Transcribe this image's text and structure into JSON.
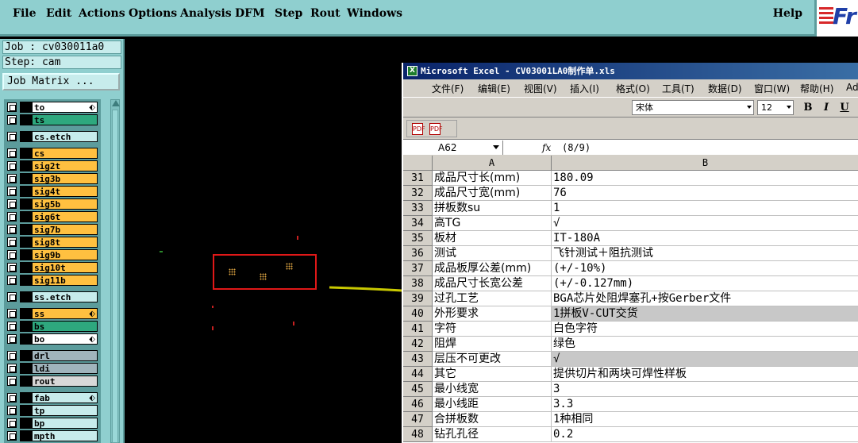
{
  "menu": {
    "items": [
      "File",
      "Edit",
      "Actions",
      "Options",
      "Analysis",
      "DFM",
      "Step",
      "Rout",
      "Windows"
    ],
    "help": "Help",
    "logo": "Fr"
  },
  "job": {
    "job_line": "Job : cv030011a0",
    "step_line": "Step: cam",
    "matrix_button": "Job Matrix ..."
  },
  "layers": [
    {
      "name": "to",
      "color": "#ffffff",
      "mark": "⬖"
    },
    {
      "name": "ts",
      "color": "#2ea87e",
      "mark": ""
    },
    {
      "name": "cs.etch",
      "color": "#c7ecec",
      "mark": ""
    },
    {
      "name": "cs",
      "color": "#ffc040",
      "mark": ""
    },
    {
      "name": "sig2t",
      "color": "#ffc040",
      "mark": ""
    },
    {
      "name": "sig3b",
      "color": "#ffc040",
      "mark": ""
    },
    {
      "name": "sig4t",
      "color": "#ffc040",
      "mark": ""
    },
    {
      "name": "sig5b",
      "color": "#ffc040",
      "mark": ""
    },
    {
      "name": "sig6t",
      "color": "#ffc040",
      "mark": ""
    },
    {
      "name": "sig7b",
      "color": "#ffc040",
      "mark": ""
    },
    {
      "name": "sig8t",
      "color": "#ffc040",
      "mark": ""
    },
    {
      "name": "sig9b",
      "color": "#ffc040",
      "mark": ""
    },
    {
      "name": "sig10t",
      "color": "#ffc040",
      "mark": ""
    },
    {
      "name": "sig11b",
      "color": "#ffc040",
      "mark": ""
    },
    {
      "name": "ss.etch",
      "color": "#c7ecec",
      "mark": ""
    },
    {
      "name": "ss",
      "color": "#ffc040",
      "mark": "⬖"
    },
    {
      "name": "bs",
      "color": "#2ea87e",
      "mark": ""
    },
    {
      "name": "bo",
      "color": "#ffffff",
      "mark": "⬖"
    },
    {
      "name": "drl",
      "color": "#a0b4bc",
      "mark": ""
    },
    {
      "name": "ldi",
      "color": "#a0b4bc",
      "mark": ""
    },
    {
      "name": "rout",
      "color": "#d8d8d8",
      "mark": ""
    },
    {
      "name": "fab",
      "color": "#c7ecec",
      "mark": "⬖"
    },
    {
      "name": "tp",
      "color": "#c7ecec",
      "mark": ""
    },
    {
      "name": "bp",
      "color": "#c7ecec",
      "mark": ""
    },
    {
      "name": "mpth",
      "color": "#c7ecec",
      "mark": ""
    }
  ],
  "excel": {
    "title": "Microsoft Excel - CV03001LA0制作单.xls",
    "icon": "X",
    "menu": [
      "文件(F)",
      "编辑(E)",
      "视图(V)",
      "插入(I)",
      "格式(O)",
      "工具(T)",
      "数据(D)",
      "窗口(W)",
      "帮助(H)",
      "Ado"
    ],
    "font_name": "宋体",
    "font_size": "12",
    "bold": "B",
    "italic": "I",
    "underline": "U",
    "pdf_icons": [
      "PDF",
      "PDF"
    ],
    "cell_ref": "A62",
    "fx": "fx",
    "formula": "(8/9)",
    "columns": [
      "A",
      "B"
    ],
    "rows": [
      {
        "num": "31",
        "a": "成品尺寸长(mm)",
        "b": "180.09",
        "shaded": false
      },
      {
        "num": "32",
        "a": "成品尺寸宽(mm)",
        "b": "76",
        "shaded": false
      },
      {
        "num": "33",
        "a": "拼板数su",
        "b": "1",
        "shaded": false
      },
      {
        "num": "34",
        "a": "高TG",
        "b": "√",
        "shaded": false
      },
      {
        "num": "35",
        "a": "板材",
        "b": "IT-180A",
        "shaded": false
      },
      {
        "num": "36",
        "a": "测试",
        "b": "飞针测试＋阻抗测试",
        "shaded": false
      },
      {
        "num": "37",
        "a": "成品板厚公差(mm)",
        "b": "(+/-10%)",
        "shaded": false
      },
      {
        "num": "38",
        "a": "成品尺寸长宽公差",
        "b": "(+/-0.127mm)",
        "shaded": false
      },
      {
        "num": "39",
        "a": "过孔工艺",
        "b": "BGA芯片处阻焊塞孔+按Gerber文件",
        "shaded": false
      },
      {
        "num": "40",
        "a": "外形要求",
        "b": "1拼板V-CUT交货",
        "shaded": true
      },
      {
        "num": "41",
        "a": "字符",
        "b": "白色字符",
        "shaded": false
      },
      {
        "num": "42",
        "a": "阻焊",
        "b": "绿色",
        "shaded": false
      },
      {
        "num": "43",
        "a": "层压不可更改",
        "b": "√",
        "shaded": true
      },
      {
        "num": "44",
        "a": "其它",
        "b": "提供切片和两块可焊性样板",
        "shaded": false
      },
      {
        "num": "45",
        "a": "最小线宽",
        "b": "3",
        "shaded": false
      },
      {
        "num": "46",
        "a": "最小线距",
        "b": "3.3",
        "shaded": false
      },
      {
        "num": "47",
        "a": "合拼板数",
        "b": "1种相同",
        "shaded": false
      },
      {
        "num": "48",
        "a": "钻孔孔径",
        "b": "0.2",
        "shaded": false
      }
    ]
  },
  "colors": {
    "panel": "#8fcfcf",
    "panel_dark": "#5c9c9c",
    "highlight_box": "#e01818",
    "arrow": "#c8c800",
    "excel_title": "#0a246a"
  }
}
